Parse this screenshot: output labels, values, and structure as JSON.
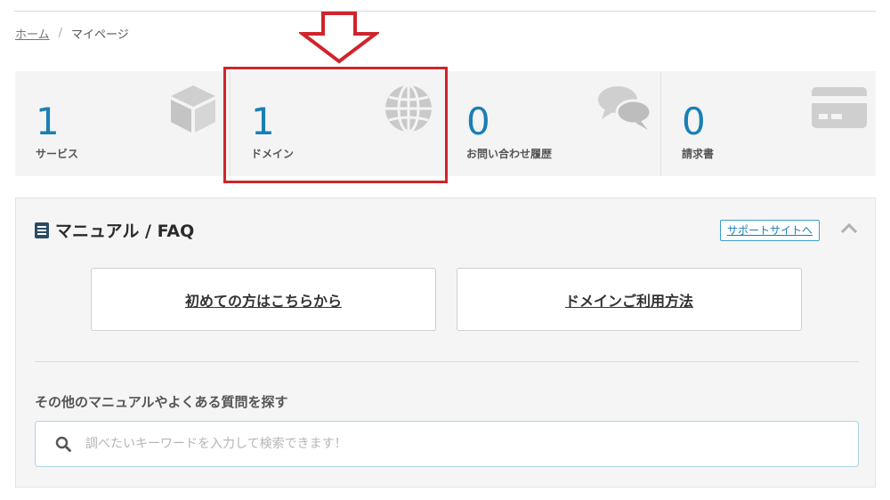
{
  "breadcrumb": {
    "home": "ホーム",
    "separator": "/",
    "current": "マイページ"
  },
  "stats": [
    {
      "value": "1",
      "label": "サービス",
      "icon": "box-icon"
    },
    {
      "value": "1",
      "label": "ドメイン",
      "icon": "globe-icon"
    },
    {
      "value": "0",
      "label": "お問い合わせ履歴",
      "icon": "chat-bubbles-icon"
    },
    {
      "value": "0",
      "label": "請求書",
      "icon": "credit-card-icon"
    }
  ],
  "colors": {
    "accent": "#1a7fb5",
    "highlight": "#d0242b",
    "icon_gray": "#c9c9c9"
  },
  "manual": {
    "title": "マニュアル / FAQ",
    "support_link": "サポートサイトへ",
    "buttons": {
      "first_time": "初めての方はこちらから",
      "domain_usage": "ドメインご利用方法"
    },
    "search_heading": "その他のマニュアルやよくある質問を探す",
    "search_placeholder": "調べたいキーワードを入力して検索できます！"
  }
}
